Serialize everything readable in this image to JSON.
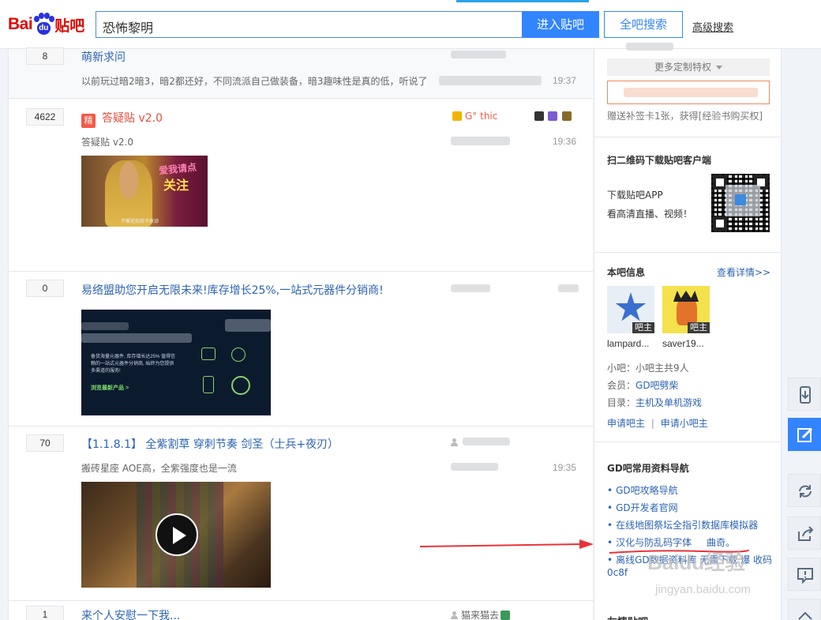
{
  "header": {
    "logo_bai": "Bai",
    "logo_du": "du",
    "logo_tieba": "贴吧",
    "search_value": "恐怖黎明",
    "enter_button": "进入贴吧",
    "all_search_button": "全吧搜索",
    "advanced_search": "高级搜索"
  },
  "threads": [
    {
      "reply_count": "8",
      "title": "萌新求问",
      "abstract": "以前玩过暗2暗3，暗2都还好，不同流派自己做装备，暗3趣味性是真的低，听说了",
      "time": "19:37"
    },
    {
      "reply_count": "4622",
      "jing": "精",
      "title": "答疑贴 v2.0",
      "author": "G° thic",
      "abstract": "答疑贴 v2.0",
      "time": "19:36",
      "image": {
        "caption1": "爱我请点",
        "caption2": "关注",
        "subtitle": "不懈追我就不原谅"
      }
    },
    {
      "reply_count": "0",
      "title": "易络盟助您开启无限未来!库存增长25%,一站式元器件分销商!",
      "image": {
        "text": "备货海量元器件, 库存增长达25% 值得信赖的一站式元器件分销商, 始终为您提供多渠道的服务!",
        "link": "浏览最新产品 >"
      }
    },
    {
      "reply_count": "70",
      "title": "【1.1.8.1】 全紫割草 穿刺节奏 剑圣（士兵+夜刃）",
      "abstract": "搬砖星座 AOE高，全紫强度也是一流",
      "time": "19:35"
    },
    {
      "reply_count": "1",
      "title": "来个人安慰一下我...",
      "author": "猫来猫去"
    }
  ],
  "sidebar": {
    "vip_bar": "更多定制特权",
    "gift_line": "赠送补签卡1张，获得[经验书购买权]",
    "qr_title": "扫二维码下载贴吧客户端",
    "qr_line1": "下载贴吧APP",
    "qr_line2": "看高清直播、视频！",
    "info_title": "本吧信息",
    "info_more": "查看详情>>",
    "admins": [
      {
        "name": "lampard...",
        "tag": "吧主"
      },
      {
        "name": "saver19...",
        "tag": "吧主"
      }
    ],
    "small_admin_label": "小吧：",
    "small_admin_value": "小吧主共9人",
    "member_label": "会员：",
    "member_value": "GD吧劈柴",
    "catalog_label": "目录：",
    "catalog_value": "主机及单机游戏",
    "apply_admin": "申请吧主",
    "apply_small_admin": "申请小吧主",
    "nav_title": "GD吧常用资料导航",
    "nav_items": [
      "GD吧攻略导航",
      "GD开发者官网",
      "在线地图祭坛全指引数据库模拟器",
      "汉化与防乱码字体     曲奇。",
      "离线GD数据资料库 无需下载 爆 收码",
      "0c8f"
    ],
    "bottom_title": "友情贴吧"
  },
  "watermark": {
    "line1": "Baidu经验",
    "line2": "jingyan.baidu.com"
  },
  "float_icons": [
    "download-icon",
    "edit-icon",
    "refresh-icon",
    "share-icon",
    "report-icon",
    "back-to-top-icon"
  ]
}
